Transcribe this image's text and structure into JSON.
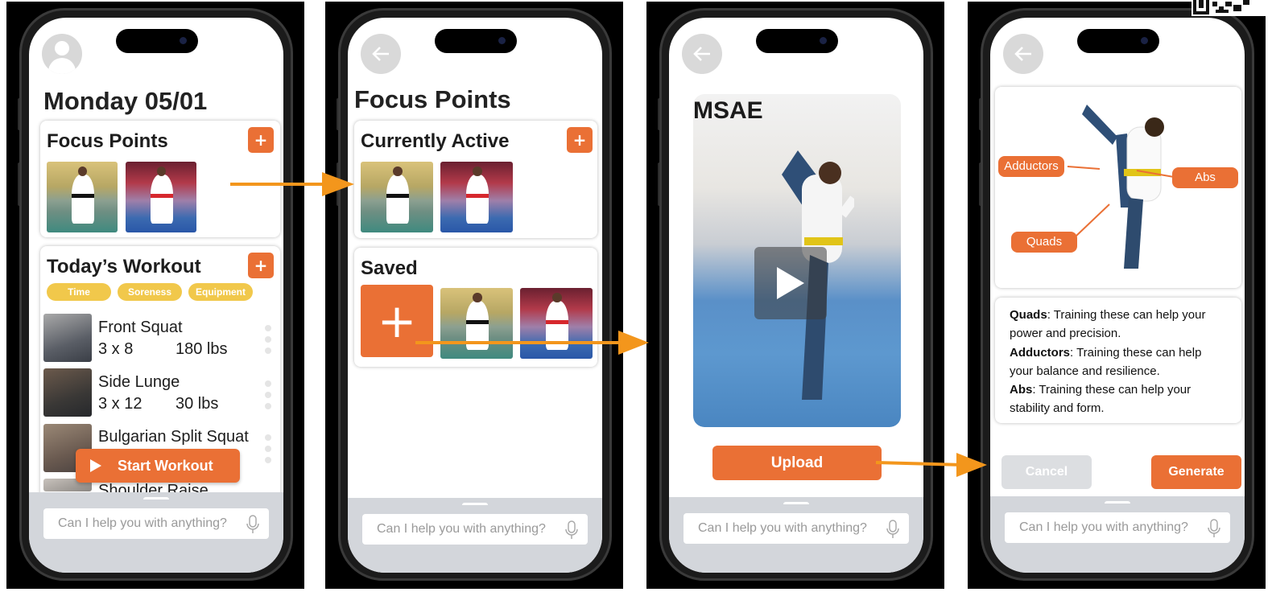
{
  "colors": {
    "accent": "#ea7035",
    "arrow": "#f3961c",
    "filter_pill": "#f1c84b",
    "assistant_bar": "#d3d6db",
    "cancel_button": "#dcdee1"
  },
  "assistant": {
    "placeholder": "Can I help you with anything?",
    "icon": "microphone-icon"
  },
  "screen1": {
    "title": "Monday 05/01",
    "focus_points": {
      "title": "Focus Points",
      "add_label": "+"
    },
    "workout": {
      "title": "Today’s Workout",
      "add_label": "+",
      "filters": [
        "Time",
        "Soreness",
        "Equipment"
      ],
      "exercises": [
        {
          "name": "Front Squat",
          "sets": "3 x 8",
          "weight": "180 lbs"
        },
        {
          "name": "Side Lunge",
          "sets": "3 x 12",
          "weight": "30 lbs"
        },
        {
          "name": "Bulgarian Split Squat",
          "sets": "",
          "weight": ""
        },
        {
          "name": "Shoulder Raise",
          "sets": "",
          "weight": ""
        }
      ]
    },
    "start_button": "Start Workout"
  },
  "screen2": {
    "title": "Focus Points",
    "active": {
      "title": "Currently Active",
      "add_label": "+"
    },
    "saved": {
      "title": "Saved",
      "add_label": "+"
    }
  },
  "screen3": {
    "video_sign": "MSAE",
    "upload_button": "Upload"
  },
  "screen4": {
    "labels": {
      "adductors": "Adductors",
      "abs": "Abs",
      "quads": "Quads"
    },
    "descriptions": [
      {
        "term": "Quads",
        "text": ": Training these can help your power and precision."
      },
      {
        "term": "Adductors",
        "text": ": Training these can help your balance and resilience."
      },
      {
        "term": "Abs",
        "text": ": Training these can help your stability and form."
      }
    ],
    "cancel_button": "Cancel",
    "generate_button": "Generate"
  }
}
